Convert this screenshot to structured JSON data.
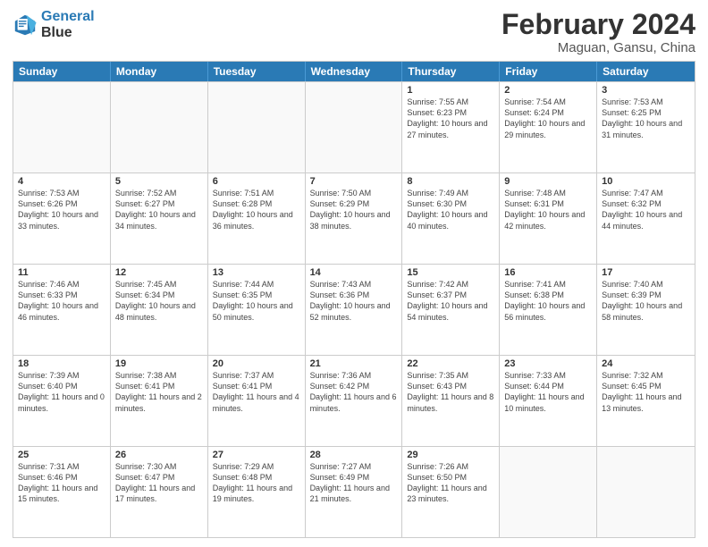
{
  "header": {
    "logo_general": "General",
    "logo_blue": "Blue",
    "month_title": "February 2024",
    "location": "Maguan, Gansu, China"
  },
  "weekdays": [
    "Sunday",
    "Monday",
    "Tuesday",
    "Wednesday",
    "Thursday",
    "Friday",
    "Saturday"
  ],
  "rows": [
    [
      {
        "day": "",
        "sunrise": "",
        "sunset": "",
        "daylight": "",
        "empty": true
      },
      {
        "day": "",
        "sunrise": "",
        "sunset": "",
        "daylight": "",
        "empty": true
      },
      {
        "day": "",
        "sunrise": "",
        "sunset": "",
        "daylight": "",
        "empty": true
      },
      {
        "day": "",
        "sunrise": "",
        "sunset": "",
        "daylight": "",
        "empty": true
      },
      {
        "day": "1",
        "sunrise": "Sunrise: 7:55 AM",
        "sunset": "Sunset: 6:23 PM",
        "daylight": "Daylight: 10 hours and 27 minutes."
      },
      {
        "day": "2",
        "sunrise": "Sunrise: 7:54 AM",
        "sunset": "Sunset: 6:24 PM",
        "daylight": "Daylight: 10 hours and 29 minutes."
      },
      {
        "day": "3",
        "sunrise": "Sunrise: 7:53 AM",
        "sunset": "Sunset: 6:25 PM",
        "daylight": "Daylight: 10 hours and 31 minutes."
      }
    ],
    [
      {
        "day": "4",
        "sunrise": "Sunrise: 7:53 AM",
        "sunset": "Sunset: 6:26 PM",
        "daylight": "Daylight: 10 hours and 33 minutes."
      },
      {
        "day": "5",
        "sunrise": "Sunrise: 7:52 AM",
        "sunset": "Sunset: 6:27 PM",
        "daylight": "Daylight: 10 hours and 34 minutes."
      },
      {
        "day": "6",
        "sunrise": "Sunrise: 7:51 AM",
        "sunset": "Sunset: 6:28 PM",
        "daylight": "Daylight: 10 hours and 36 minutes."
      },
      {
        "day": "7",
        "sunrise": "Sunrise: 7:50 AM",
        "sunset": "Sunset: 6:29 PM",
        "daylight": "Daylight: 10 hours and 38 minutes."
      },
      {
        "day": "8",
        "sunrise": "Sunrise: 7:49 AM",
        "sunset": "Sunset: 6:30 PM",
        "daylight": "Daylight: 10 hours and 40 minutes."
      },
      {
        "day": "9",
        "sunrise": "Sunrise: 7:48 AM",
        "sunset": "Sunset: 6:31 PM",
        "daylight": "Daylight: 10 hours and 42 minutes."
      },
      {
        "day": "10",
        "sunrise": "Sunrise: 7:47 AM",
        "sunset": "Sunset: 6:32 PM",
        "daylight": "Daylight: 10 hours and 44 minutes."
      }
    ],
    [
      {
        "day": "11",
        "sunrise": "Sunrise: 7:46 AM",
        "sunset": "Sunset: 6:33 PM",
        "daylight": "Daylight: 10 hours and 46 minutes."
      },
      {
        "day": "12",
        "sunrise": "Sunrise: 7:45 AM",
        "sunset": "Sunset: 6:34 PM",
        "daylight": "Daylight: 10 hours and 48 minutes."
      },
      {
        "day": "13",
        "sunrise": "Sunrise: 7:44 AM",
        "sunset": "Sunset: 6:35 PM",
        "daylight": "Daylight: 10 hours and 50 minutes."
      },
      {
        "day": "14",
        "sunrise": "Sunrise: 7:43 AM",
        "sunset": "Sunset: 6:36 PM",
        "daylight": "Daylight: 10 hours and 52 minutes."
      },
      {
        "day": "15",
        "sunrise": "Sunrise: 7:42 AM",
        "sunset": "Sunset: 6:37 PM",
        "daylight": "Daylight: 10 hours and 54 minutes."
      },
      {
        "day": "16",
        "sunrise": "Sunrise: 7:41 AM",
        "sunset": "Sunset: 6:38 PM",
        "daylight": "Daylight: 10 hours and 56 minutes."
      },
      {
        "day": "17",
        "sunrise": "Sunrise: 7:40 AM",
        "sunset": "Sunset: 6:39 PM",
        "daylight": "Daylight: 10 hours and 58 minutes."
      }
    ],
    [
      {
        "day": "18",
        "sunrise": "Sunrise: 7:39 AM",
        "sunset": "Sunset: 6:40 PM",
        "daylight": "Daylight: 11 hours and 0 minutes."
      },
      {
        "day": "19",
        "sunrise": "Sunrise: 7:38 AM",
        "sunset": "Sunset: 6:41 PM",
        "daylight": "Daylight: 11 hours and 2 minutes."
      },
      {
        "day": "20",
        "sunrise": "Sunrise: 7:37 AM",
        "sunset": "Sunset: 6:41 PM",
        "daylight": "Daylight: 11 hours and 4 minutes."
      },
      {
        "day": "21",
        "sunrise": "Sunrise: 7:36 AM",
        "sunset": "Sunset: 6:42 PM",
        "daylight": "Daylight: 11 hours and 6 minutes."
      },
      {
        "day": "22",
        "sunrise": "Sunrise: 7:35 AM",
        "sunset": "Sunset: 6:43 PM",
        "daylight": "Daylight: 11 hours and 8 minutes."
      },
      {
        "day": "23",
        "sunrise": "Sunrise: 7:33 AM",
        "sunset": "Sunset: 6:44 PM",
        "daylight": "Daylight: 11 hours and 10 minutes."
      },
      {
        "day": "24",
        "sunrise": "Sunrise: 7:32 AM",
        "sunset": "Sunset: 6:45 PM",
        "daylight": "Daylight: 11 hours and 13 minutes."
      }
    ],
    [
      {
        "day": "25",
        "sunrise": "Sunrise: 7:31 AM",
        "sunset": "Sunset: 6:46 PM",
        "daylight": "Daylight: 11 hours and 15 minutes."
      },
      {
        "day": "26",
        "sunrise": "Sunrise: 7:30 AM",
        "sunset": "Sunset: 6:47 PM",
        "daylight": "Daylight: 11 hours and 17 minutes."
      },
      {
        "day": "27",
        "sunrise": "Sunrise: 7:29 AM",
        "sunset": "Sunset: 6:48 PM",
        "daylight": "Daylight: 11 hours and 19 minutes."
      },
      {
        "day": "28",
        "sunrise": "Sunrise: 7:27 AM",
        "sunset": "Sunset: 6:49 PM",
        "daylight": "Daylight: 11 hours and 21 minutes."
      },
      {
        "day": "29",
        "sunrise": "Sunrise: 7:26 AM",
        "sunset": "Sunset: 6:50 PM",
        "daylight": "Daylight: 11 hours and 23 minutes."
      },
      {
        "day": "",
        "sunrise": "",
        "sunset": "",
        "daylight": "",
        "empty": true
      },
      {
        "day": "",
        "sunrise": "",
        "sunset": "",
        "daylight": "",
        "empty": true
      }
    ]
  ]
}
